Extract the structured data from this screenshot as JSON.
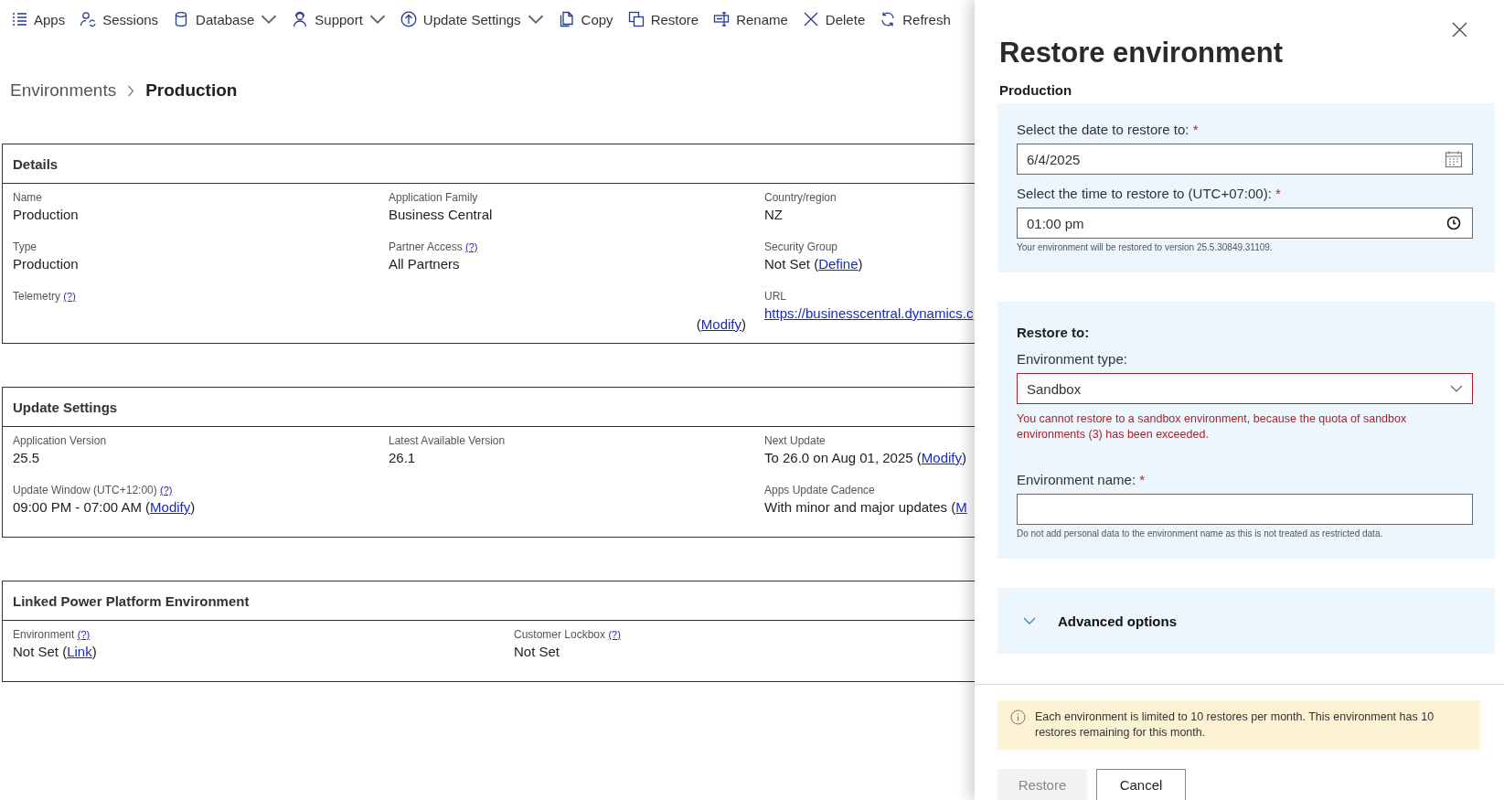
{
  "toolbar": [
    {
      "label": "Apps",
      "menu": false
    },
    {
      "label": "Sessions",
      "menu": false
    },
    {
      "label": "Database",
      "menu": true
    },
    {
      "label": "Support",
      "menu": true
    },
    {
      "label": "Update Settings",
      "menu": true
    },
    {
      "label": "Copy",
      "menu": false
    },
    {
      "label": "Restore",
      "menu": false
    },
    {
      "label": "Rename",
      "menu": false
    },
    {
      "label": "Delete",
      "menu": false
    },
    {
      "label": "Refresh",
      "menu": false
    }
  ],
  "breadcrumb": {
    "parent": "Environments",
    "current": "Production"
  },
  "sections": [
    {
      "title": "Details",
      "columns": [
        [
          {
            "label": "Name",
            "parts": [
              {
                "text": "Production"
              }
            ]
          },
          {
            "label": "Type",
            "parts": [
              {
                "text": "Production"
              }
            ]
          },
          {
            "label": "Telemetry",
            "help": "(?)"
          }
        ],
        [
          {
            "label": "Application Family",
            "parts": [
              {
                "text": "Business Central"
              }
            ]
          },
          {
            "label": "Partner Access",
            "help": "(?)",
            "parts": [
              {
                "text": "All Partners"
              }
            ]
          },
          {
            "kind": "action",
            "parts": [
              {
                "text": "("
              },
              {
                "link": "Modify"
              },
              {
                "text": ")"
              }
            ]
          }
        ],
        [
          {
            "label": "Country/region",
            "parts": [
              {
                "text": "NZ"
              }
            ]
          },
          {
            "label": "Security Group",
            "parts": [
              {
                "text": "Not Set ("
              },
              {
                "link": "Define"
              },
              {
                "text": ")"
              }
            ]
          },
          {
            "label": "URL",
            "parts": [
              {
                "link": "https://businesscentral.dynamics.c"
              }
            ]
          }
        ]
      ]
    },
    {
      "title": "Update Settings",
      "columns": [
        [
          {
            "label": "Application Version",
            "parts": [
              {
                "text": "25.5"
              }
            ]
          },
          {
            "label": "Update Window (UTC+12:00)",
            "help": "(?)",
            "parts": [
              {
                "text": "09:00 PM - 07:00 AM ("
              },
              {
                "link": "Modify"
              },
              {
                "text": ")"
              }
            ]
          }
        ],
        [
          {
            "label": "Latest Available Version",
            "parts": [
              {
                "text": "26.1"
              }
            ]
          }
        ],
        [
          {
            "label": "Next Update",
            "parts": [
              {
                "text": "To 26.0 on Aug 01, 2025 ("
              },
              {
                "link": "Modify"
              },
              {
                "text": ")"
              }
            ]
          },
          {
            "label": "Apps Update Cadence",
            "parts": [
              {
                "text": "With minor and major updates ("
              },
              {
                "link": "M"
              }
            ]
          }
        ]
      ]
    },
    {
      "title": "Linked Power Platform Environment",
      "columns": [
        [
          {
            "label": "Environment",
            "help": "(?)",
            "parts": [
              {
                "text": "Not Set ("
              },
              {
                "link": "Link"
              },
              {
                "text": ")"
              }
            ]
          }
        ],
        [
          {
            "label": "Customer Lockbox",
            "help": "(?)",
            "parts": [
              {
                "text": "Not Set"
              }
            ]
          }
        ]
      ]
    }
  ],
  "panel": {
    "title": "Restore environment",
    "subtitle": "Production",
    "date": {
      "label": "Select the date to restore to:",
      "mark": "*",
      "value": "6/4/2025"
    },
    "time": {
      "label": "Select the time to restore to (UTC+07:00):",
      "mark": "*",
      "value": "01:00 pm",
      "hint": "Your environment will be restored to version 25.5.30849.31109."
    },
    "restore_to": {
      "heading": "Restore to:",
      "type": {
        "label": "Environment type:",
        "value": "Sandbox",
        "error": "You cannot restore to a sandbox environment, because the quota of sandbox environments (3) has been exceeded."
      },
      "name": {
        "label": "Environment name:",
        "mark": "*",
        "hint": "Do not add personal data to the environment name as this is not treated as restricted data."
      }
    },
    "advanced": {
      "label": "Advanced options",
      "expanded": false
    },
    "info": "Each environment is limited to 10 restores per month. This environment has 10 restores remaining for this month.",
    "buttons": [
      {
        "label": "Restore",
        "disabled": true
      },
      {
        "label": "Cancel",
        "disabled": false
      }
    ]
  }
}
